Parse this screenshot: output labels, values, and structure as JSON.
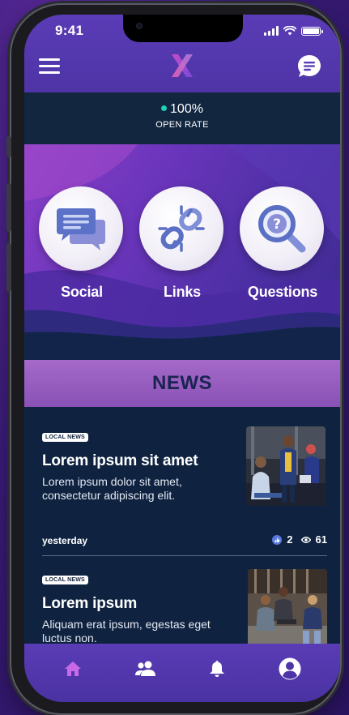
{
  "status_bar": {
    "time": "9:41"
  },
  "header": {
    "menu_icon": "hamburger-icon",
    "logo": "X",
    "chat_icon": "chat-bubble-icon"
  },
  "open_rate": {
    "value": "100%",
    "label": "OPEN RATE",
    "dot_color": "#1fd1b2"
  },
  "categories": [
    {
      "label": "Social",
      "icon": "chat-bubbles-icon"
    },
    {
      "label": "Links",
      "icon": "broken-link-icon"
    },
    {
      "label": "Questions",
      "icon": "magnifier-question-icon"
    }
  ],
  "news": {
    "title": "NEWS",
    "items": [
      {
        "badge": "LOCAL NEWS",
        "title": "Lorem ipsum sit amet",
        "body": "Lorem ipsum dolor sit amet, consectetur adipiscing elit.",
        "when": "yesterday",
        "likes": "2",
        "views": "61"
      },
      {
        "badge": "LOCAL NEWS",
        "title": "Lorem ipsum",
        "body": "Aliquam erat ipsum, egestas eget luctus non."
      }
    ]
  },
  "tabbar": {
    "tabs": [
      {
        "icon": "home-icon",
        "active": true
      },
      {
        "icon": "users-icon",
        "active": false
      },
      {
        "icon": "bell-icon",
        "active": false
      },
      {
        "icon": "profile-icon",
        "active": false
      }
    ],
    "active_color": "#c86ae8",
    "inactive_color": "#ffffff"
  },
  "colors": {
    "header": "#5a3cb6",
    "dark_bg": "#0f2340",
    "news_banner": "#a469c9",
    "accent_teal": "#1fd1b2"
  }
}
